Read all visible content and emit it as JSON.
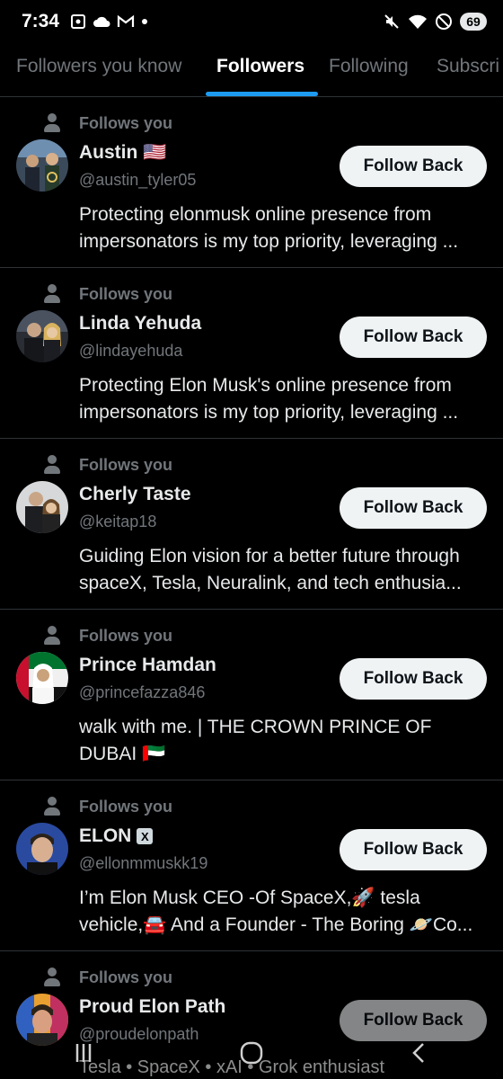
{
  "status": {
    "time": "7:34",
    "battery": "69"
  },
  "tabs": [
    {
      "label": "Followers you know"
    },
    {
      "label": "Followers"
    },
    {
      "label": "Following"
    },
    {
      "label": "Subscri"
    }
  ],
  "rows": [
    {
      "follows": "Follows you",
      "name": "Austin 🇺🇸",
      "handle": "@austin_tyler05",
      "bio1": "Protecting elonmusk online presence from",
      "bio2": "impersonators is my top priority, leveraging ...",
      "button": "Follow Back"
    },
    {
      "follows": "Follows you",
      "name": "Linda Yehuda",
      "handle": "@lindayehuda",
      "bio1": "Protecting Elon Musk's online presence from",
      "bio2": "impersonators is my top priority, leveraging ...",
      "button": "Follow Back"
    },
    {
      "follows": "Follows you",
      "name": "Cherly Taste",
      "handle": "@keitap18",
      "bio1": "Guiding Elon vision for a better future through",
      "bio2": "spaceX, Tesla, Neuralink, and tech enthusia...",
      "button": "Follow Back"
    },
    {
      "follows": "Follows you",
      "name": "Prince Hamdan",
      "handle": "@princefazza846",
      "bio1": "walk with me. | THE CROWN PRINCE OF",
      "bio2": "DUBAI 🇦🇪",
      "button": "Follow Back"
    },
    {
      "follows": "Follows you",
      "name": "ELON",
      "handle": "@ellonmmuskk19",
      "bio1": "I’m Elon Musk CEO -Of SpaceX,🚀 tesla",
      "bio2": "vehicle,🚘 And a Founder - The Boring 🪐Co...",
      "button": "Follow Back"
    },
    {
      "follows": "Follows you",
      "name": "Proud Elon Path",
      "handle": "@proudelonpath",
      "bio1": "",
      "bio2": "",
      "button": "Follow Back"
    }
  ],
  "bottom_bio": "Tesla • SpaceX • xAI • Grok enthusiast",
  "colors": {
    "background": "#000000",
    "accent": "#1d9bf0",
    "muted": "#71767b",
    "button": "#eff3f4"
  }
}
